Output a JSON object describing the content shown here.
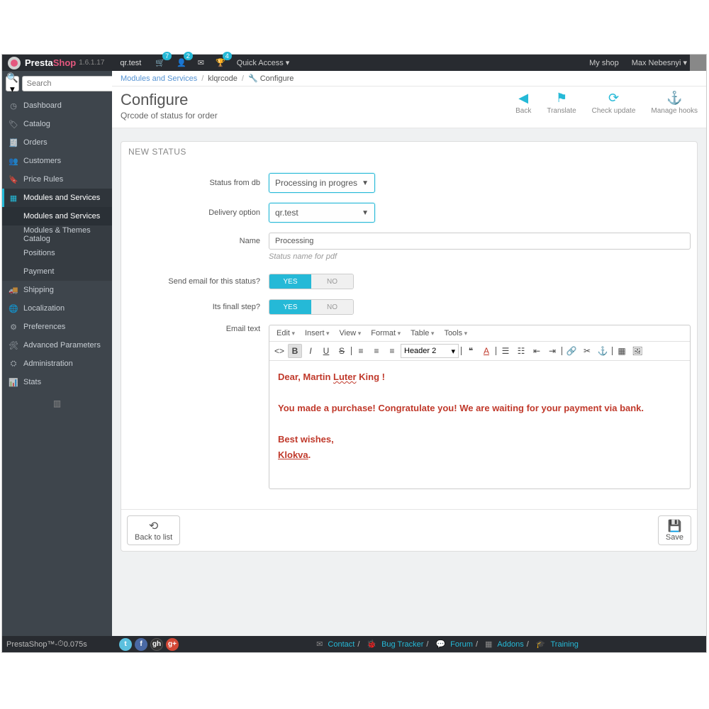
{
  "brand": {
    "name1": "Presta",
    "name2": "Shop",
    "version": "1.6.1.17",
    "shop": "qr.test"
  },
  "top": {
    "badge_cart": "7",
    "badge_user": "2",
    "badge_trophy": "4",
    "quick": "Quick Access",
    "myshop": "My shop",
    "user": "Max Nebesnyi"
  },
  "search": {
    "placeholder": "Search"
  },
  "nav": {
    "items": [
      "Dashboard",
      "Catalog",
      "Orders",
      "Customers",
      "Price Rules",
      "Modules and Services",
      "Shipping",
      "Localization",
      "Preferences",
      "Advanced Parameters",
      "Administration",
      "Stats"
    ],
    "sub": [
      "Modules and Services",
      "Modules & Themes Catalog",
      "Positions",
      "Payment"
    ]
  },
  "crumbs": {
    "a": "Modules and Services",
    "b": "klqrcode",
    "c": "Configure"
  },
  "page": {
    "title": "Configure",
    "subtitle": "Qrcode of status for order"
  },
  "headbtns": {
    "back": "Back",
    "translate": "Translate",
    "check": "Check update",
    "hooks": "Manage hooks"
  },
  "panel": {
    "title": "NEW STATUS",
    "back": "Back to list",
    "save": "Save"
  },
  "form": {
    "status_lbl": "Status from db",
    "status_val": "Processing in progres",
    "delivery_lbl": "Delivery option",
    "delivery_val": "qr.test",
    "name_lbl": "Name",
    "name_val": "Processing",
    "name_hint": "Status name for pdf",
    "send_lbl": "Send email for this status?",
    "final_lbl": "Its finall step?",
    "yes": "YES",
    "no": "NO",
    "email_lbl": "Email text"
  },
  "editor": {
    "menus": [
      "Edit",
      "Insert",
      "View",
      "Format",
      "Table",
      "Tools"
    ],
    "format_sel": "Header 2",
    "content": {
      "l1a": "Dear, Martin ",
      "l1b": "Luter",
      "l1c": " King !",
      "l2": "You made a purchase! Congratulate you! We are waiting for your payment via bank.",
      "l3": "Best wishes,",
      "l4a": "Klokva",
      "l4b": "."
    }
  },
  "footer": {
    "left": "PrestaShop™",
    "dash": " - ",
    "time": "0.075s",
    "contact": "Contact",
    "bug": "Bug Tracker",
    "forum": "Forum",
    "addons": "Addons",
    "training": "Training"
  }
}
